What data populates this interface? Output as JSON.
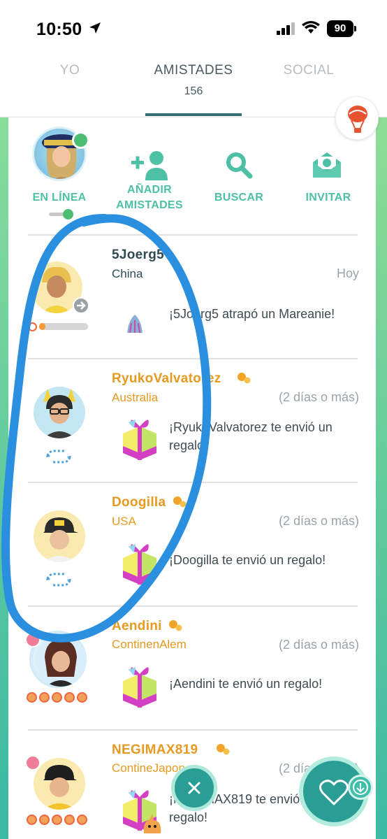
{
  "status_bar": {
    "time": "10:50",
    "battery": "90"
  },
  "tabs": [
    {
      "label": "YO"
    },
    {
      "label": "AMISTADES",
      "count": "156"
    },
    {
      "label": "SOCIAL"
    }
  ],
  "actions": {
    "online_label": "EN LÍNEA",
    "add_label_1": "AÑADIR",
    "add_label_2": "AMISTADES",
    "search_label": "BUSCAR",
    "invite_label": "INVITAR"
  },
  "friends": [
    {
      "name": "5Joerg5",
      "country": "China",
      "time": "Hoy",
      "message": "¡5Joerg5 atrapó un Mareanie!"
    },
    {
      "name": "RyukoValvatorez",
      "country": "Australia",
      "time": "(2 días o más)",
      "message_1": "¡RyukoValvatorez te envió un",
      "message_2": "regalo!"
    },
    {
      "name": "Doogilla",
      "country": "USA",
      "time": "(2 días o más)",
      "message": "¡Doogilla te envió un regalo!"
    },
    {
      "name": "Aendini",
      "country": "ContinenAlem",
      "time": "(2 días o más)",
      "message": "¡Aendini te envió un regalo!"
    },
    {
      "name": "NEGIMAX819",
      "country": "ContineJapon",
      "time": "(2 días o más)",
      "message_1": "¡NEGIMAX819 te envió un",
      "message_2": "regalo!"
    }
  ],
  "colors": {
    "accent_teal": "#4dc0a5",
    "name_orange": "#e69a21",
    "annotation_blue": "#2b8fe0",
    "online_green": "#4dbd71"
  },
  "icons": [
    "location-arrow-icon",
    "signal-icon",
    "wifi-icon",
    "add-friend-icon",
    "search-icon",
    "invite-icon",
    "balloon-icon",
    "swap-icon",
    "gift-icon",
    "close-icon",
    "heart-icon",
    "download-icon"
  ]
}
